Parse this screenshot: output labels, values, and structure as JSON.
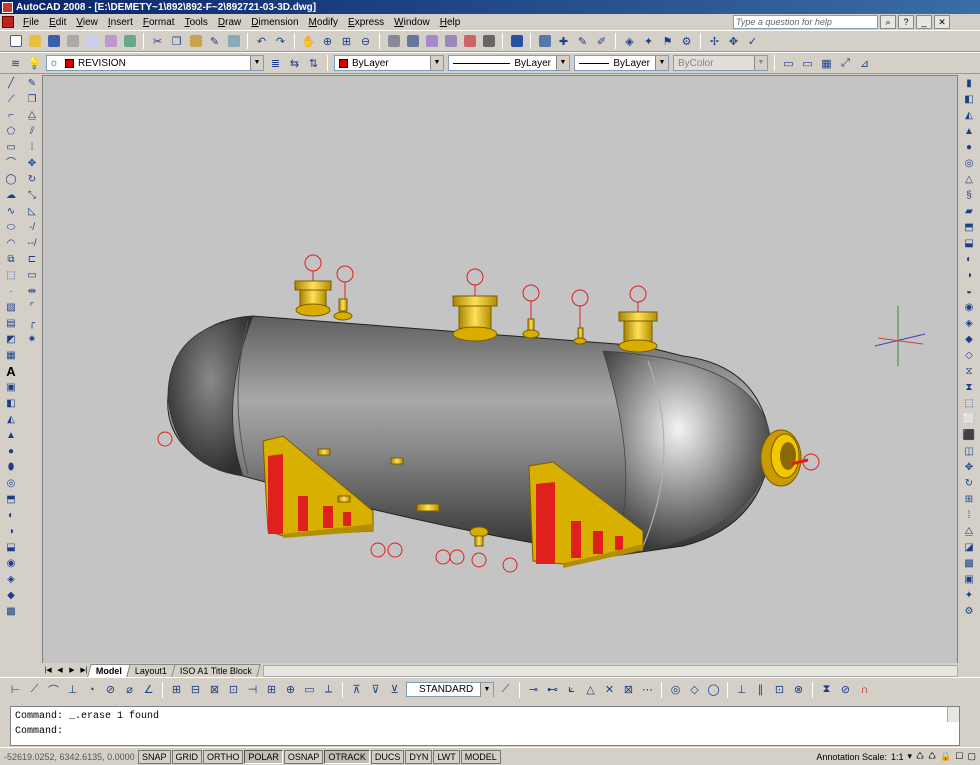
{
  "window": {
    "title": "AutoCAD 2008 - [E:\\DEMETY~1\\892\\892-F~2\\892721-03-3D.dwg]"
  },
  "menu": [
    "File",
    "Edit",
    "View",
    "Insert",
    "Format",
    "Tools",
    "Draw",
    "Dimension",
    "Modify",
    "Express",
    "Window",
    "Help"
  ],
  "help": {
    "placeholder": "Type a question for help"
  },
  "layers": {
    "current": "REVISION"
  },
  "properties": {
    "color": "ByLayer",
    "linetype": "ByLayer",
    "lineweight": "ByLayer",
    "plotstyle": "ByColor"
  },
  "layout_tabs": [
    "Model",
    "Layout1",
    "ISO A1 Title Block"
  ],
  "dimstyle": {
    "current": "STANDARD"
  },
  "command": {
    "line1": "Command:  _.erase 1 found",
    "line2": "Command:"
  },
  "status": {
    "coords": "-52619.0252, 6342.6135, 0.0000",
    "toggles": [
      "SNAP",
      "GRID",
      "ORTHO",
      "POLAR",
      "OSNAP",
      "OTRACK",
      "DUCS",
      "DYN",
      "LWT",
      "MODEL"
    ],
    "annotation_scale_label": "Annotation Scale:",
    "annotation_scale": "1:1"
  },
  "colors": {
    "vessel": "#8a8a8a",
    "nozzle": "#f2c600",
    "saddle_red": "#e01f1f",
    "canvas": "#c4c4c4"
  }
}
